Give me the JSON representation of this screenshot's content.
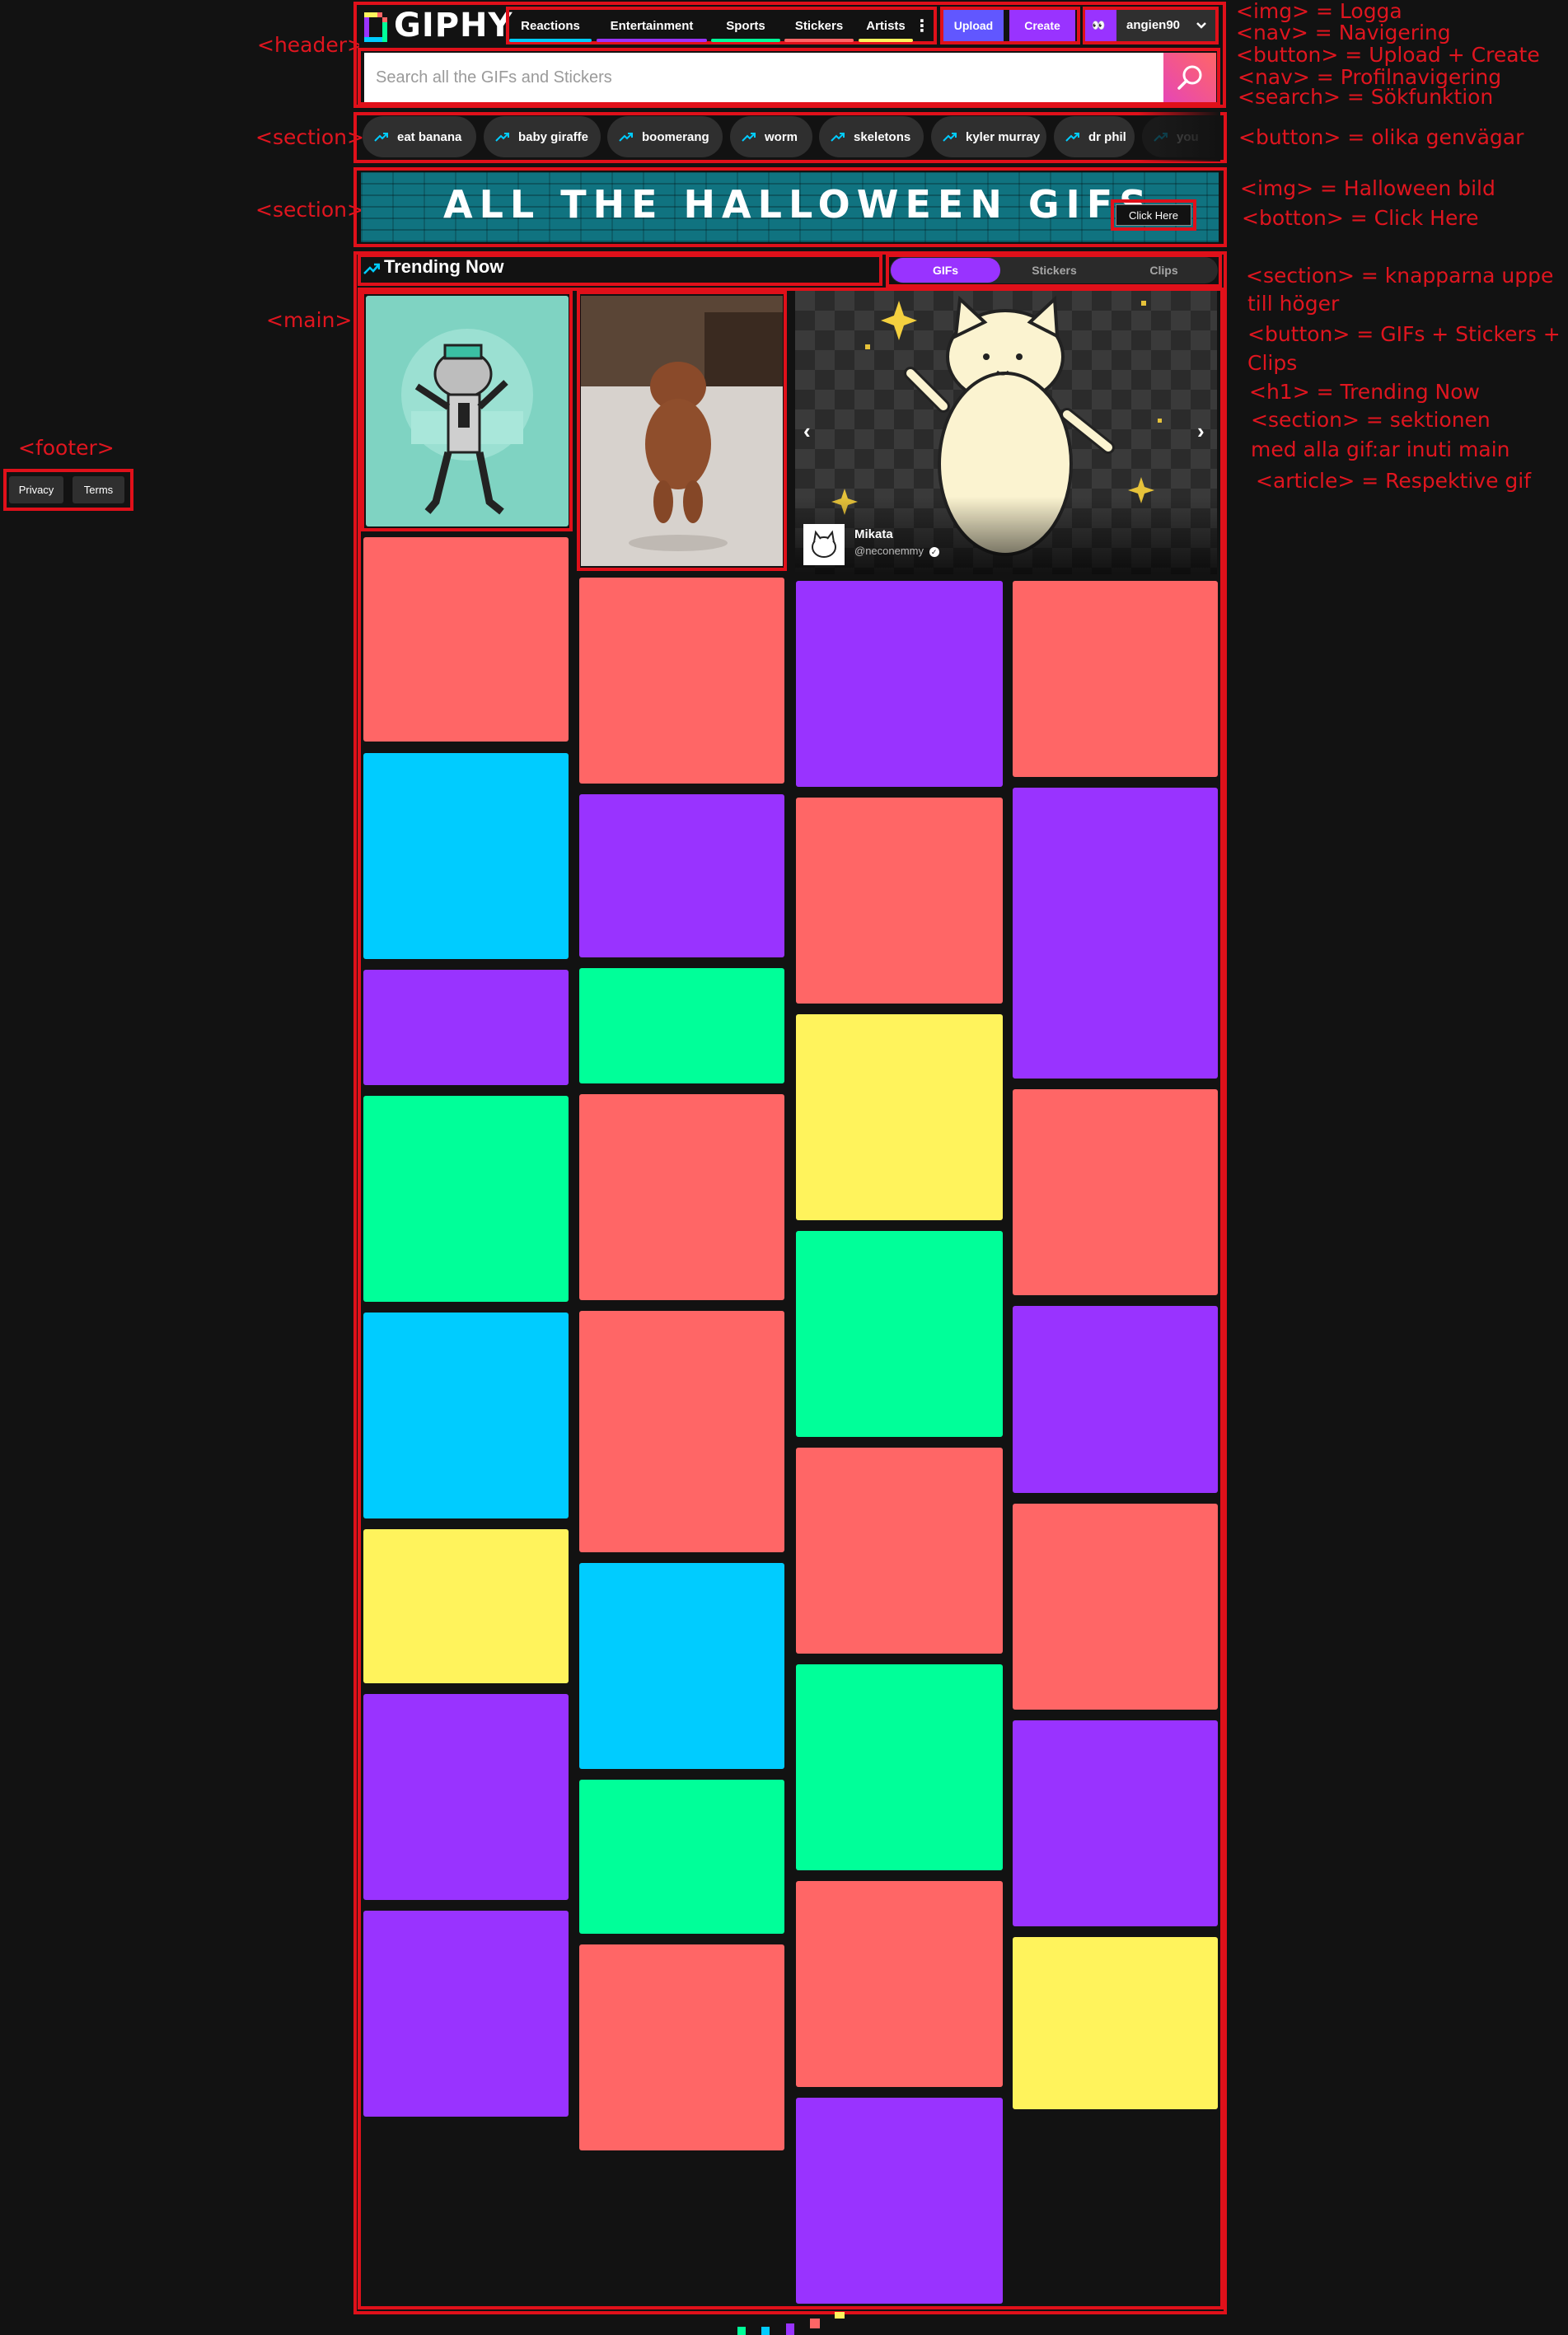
{
  "header": {
    "logo_text": "GIPHY",
    "nav": [
      "Reactions",
      "Entertainment",
      "Sports",
      "Stickers",
      "Artists"
    ],
    "upload_label": "Upload",
    "create_label": "Create",
    "username": "angien90"
  },
  "search": {
    "placeholder": "Search all the GIFs and Stickers"
  },
  "trending_chips": [
    "eat banana",
    "baby giraffe",
    "boomerang",
    "worm",
    "skeletons",
    "kyler murray",
    "dr phil",
    "you"
  ],
  "banner": {
    "title": "ALL THE HALLOWEEN GIFS",
    "button_label": "Click Here"
  },
  "trending": {
    "title": "Trending Now",
    "tabs": [
      "GIFs",
      "Stickers",
      "Clips"
    ],
    "active_tab": "GIFs"
  },
  "featured": {
    "name": "Mikata",
    "handle": "@neconemmy"
  },
  "footer": {
    "privacy": "Privacy",
    "terms": "Terms"
  },
  "annotations": {
    "header": "<header>",
    "section_1": "<section>",
    "section_2": "<section>",
    "main": "<main>",
    "footer": "<footer>",
    "right_1": "<img> = Logga",
    "right_2": "<nav> = Navigering",
    "right_3": "<button> = Upload + Create",
    "right_4": "<nav> = Profilnavigering",
    "right_5": "<search> = Sökfunktion",
    "right_6": "<button> = olika genvägar",
    "right_7": "<img> = Halloween bild",
    "right_8": "<botton> = Click Here",
    "right_9": "<section> = knapparna uppe",
    "right_10": "till höger",
    "right_11": "<button> = GIFs + Stickers +",
    "right_12": "Clips",
    "right_13": "<h1> = Trending Now",
    "right_14": "<section> = sektionen",
    "right_15": "med alla gif:ar inuti main",
    "right_16": "<article> = Respektive gif"
  }
}
